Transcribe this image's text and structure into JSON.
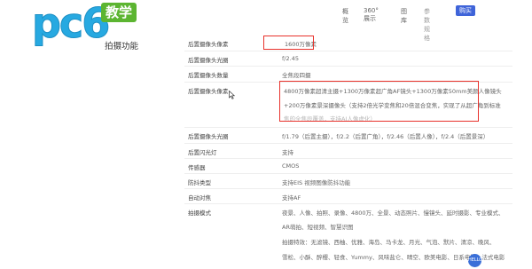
{
  "logo": {
    "text": "pc6",
    "badge": "教学"
  },
  "nav": {
    "items": [
      "概览",
      "360°展示",
      "图库",
      "参数规格"
    ],
    "buy": "购买"
  },
  "section_title": "拍摄功能",
  "rows": [
    {
      "label": "后置摄像头像素",
      "value": "1600万像素"
    },
    {
      "label": "后置摄像头光圈",
      "value": "f/2.45"
    },
    {
      "label": "后置摄像头数量",
      "value": "全焦段四摄"
    },
    {
      "label": "后置摄像头像素",
      "value": "4800万像素超清主摄+1300万像素超广角AF镜头+1300万像素50mm美颜人像镜头"
    },
    {
      "label": "",
      "value": "+200万像素景深摄像头（支持2倍光学变焦和20倍混合变焦，实现了从超广角到标准"
    },
    {
      "label": "",
      "value": "焦的全焦段覆盖，支持AI人像虚化）"
    },
    {
      "label": "后置摄像头光圈",
      "value": "f/1.79（后置主摄），f/2.2（后置广角），f/2.46（后置人像），f/2.4（后置景深）"
    },
    {
      "label": "后置闪光灯",
      "value": "支持"
    },
    {
      "label": "传感器",
      "value": "CMOS"
    },
    {
      "label": "防抖类型",
      "value": "支持EIS 视频图像防抖功能"
    },
    {
      "label": "自动对焦",
      "value": "支持AF"
    },
    {
      "label": "拍摄模式",
      "value": "夜景、人像、拍照、录像、4800万、全景、动态照片、慢镜头、延时摄影、专业模式、"
    },
    {
      "label": "",
      "value": "AR萌拍、短视频、智慧识图"
    },
    {
      "label": "",
      "value": "拍摄特效：无滤镜、西柚、优雅、海岛、马卡龙、月光、气泡、默片、清凉、晚风、"
    },
    {
      "label": "",
      "value": "雪松、小酥、醉樱、轻食、Yummy、风味盐仑、晴空、欧美电影、日系电影、法式电影"
    }
  ],
  "float_button": "HELLO",
  "colors": {
    "highlight": "#e8322c",
    "brand_blue": "#27a9e1",
    "badge_green": "#5cb531",
    "buy_blue": "#3f64d9"
  }
}
